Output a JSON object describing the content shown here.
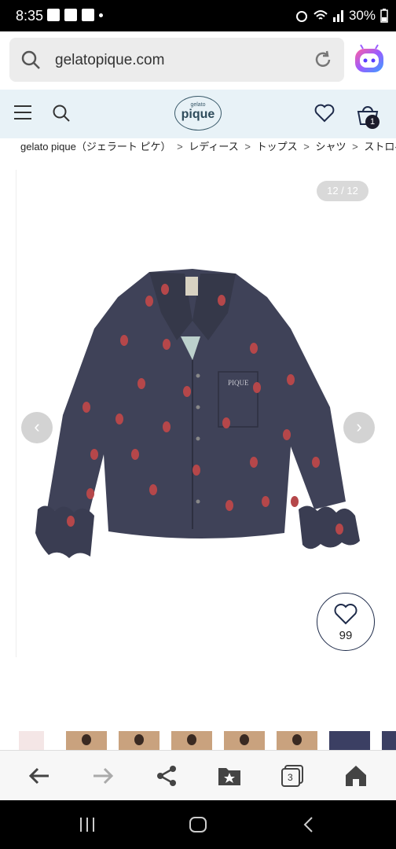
{
  "status": {
    "time": "8:35",
    "battery": "30%"
  },
  "browser": {
    "url": "gelatopique.com",
    "tabs_count": "3"
  },
  "header": {
    "logo_small": "gelato",
    "logo_main": "pique",
    "cart_count": "1"
  },
  "breadcrumb": {
    "items": [
      "gelato pique（ジェラート ピケ）",
      "レディース",
      "トップス",
      "シャツ",
      "ストロベ"
    ],
    "separator": ">"
  },
  "gallery": {
    "counter": "12 / 12",
    "like_count": "99"
  },
  "colors": {
    "header_bg": "#e8f2f7",
    "shirt": "#3f4258",
    "strawberry": "#b5474a",
    "accent": "#1e2b4a"
  }
}
